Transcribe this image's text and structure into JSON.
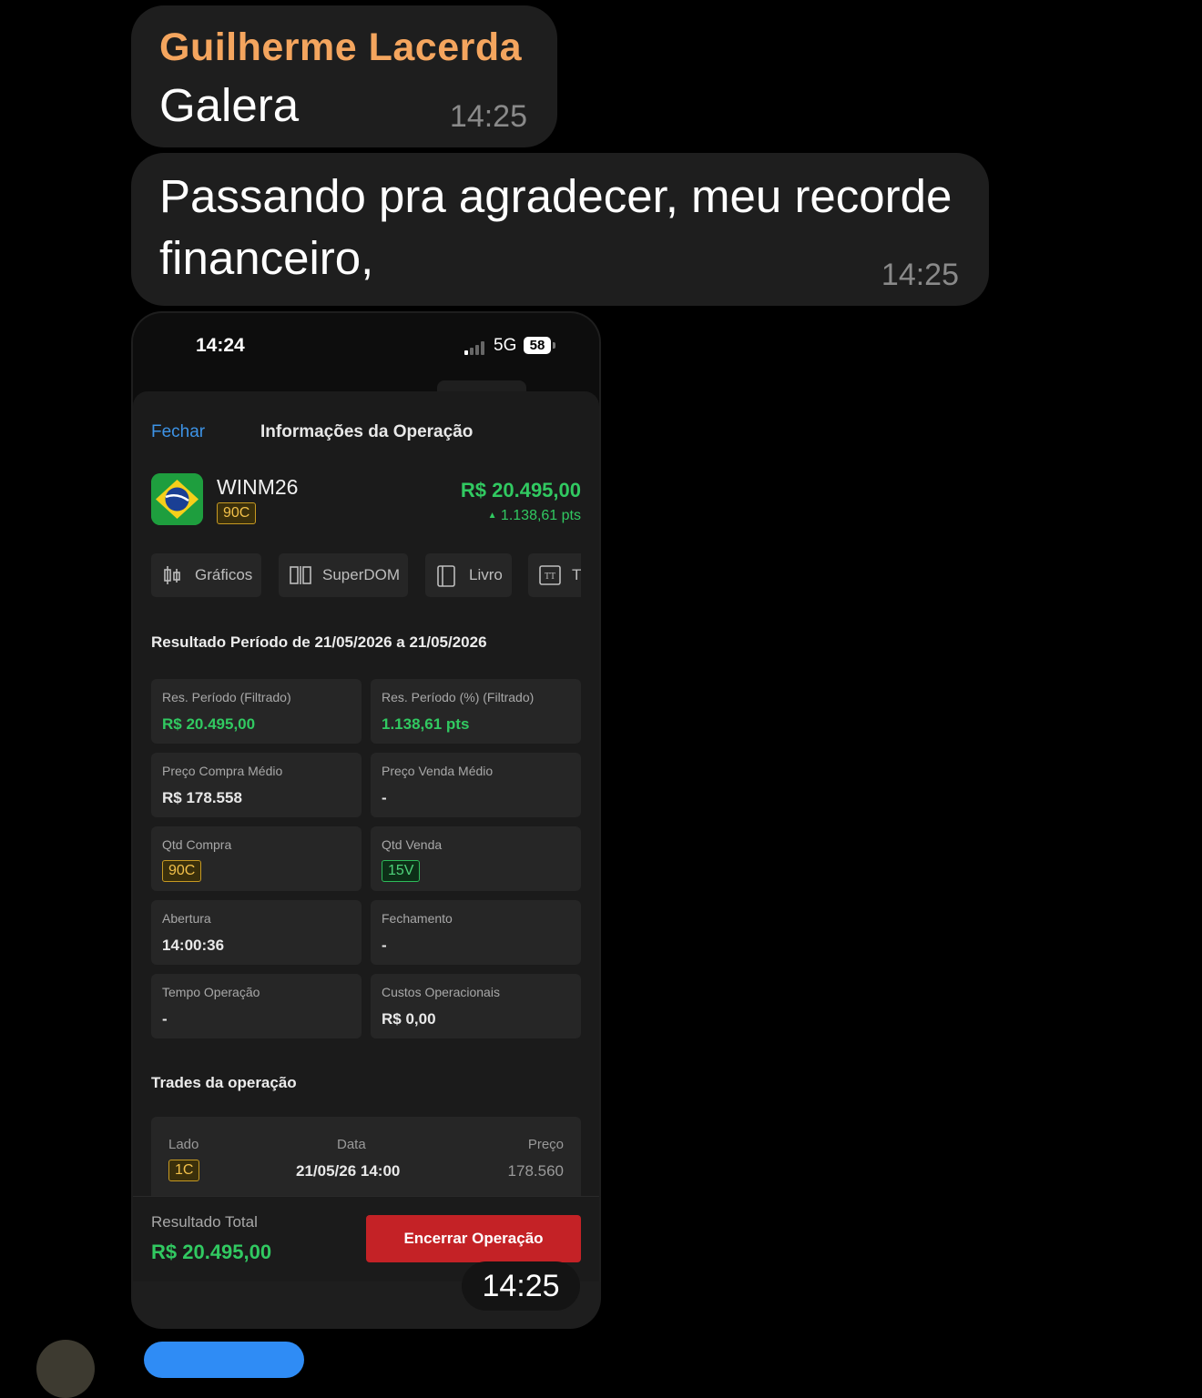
{
  "messages": [
    {
      "sender": "Guilherme Lacerda",
      "text": "Galera",
      "time": "14:25"
    },
    {
      "text": "Passando pra agradecer, meu recorde financeiro,",
      "time": "14:25"
    }
  ],
  "image_message": {
    "time": "14:25",
    "phone": {
      "status_time": "14:24",
      "network": "5G",
      "battery": "58",
      "header": {
        "close_label": "Fechar",
        "title": "Informações da Operação"
      },
      "asset": {
        "symbol": "WINM26",
        "position_badge": "90C",
        "result": "R$ 20.495,00",
        "points": "1.138,61 pts"
      },
      "tabs": [
        "Gráficos",
        "SuperDOM",
        "Livro",
        "T"
      ],
      "period_title": "Resultado Período de 21/05/2026 a 21/05/2026",
      "cards": {
        "res_periodo": {
          "label": "Res. Período (Filtrado)",
          "value": "R$ 20.495,00"
        },
        "res_periodo_pct": {
          "label": "Res. Período (%) (Filtrado)",
          "value": "1.138,61 pts"
        },
        "preco_compra": {
          "label": "Preço Compra Médio",
          "value": "R$ 178.558"
        },
        "preco_venda": {
          "label": "Preço Venda Médio",
          "value": "-"
        },
        "qtd_compra": {
          "label": "Qtd Compra",
          "value": "90C"
        },
        "qtd_venda": {
          "label": "Qtd Venda",
          "value": "15V"
        },
        "abertura": {
          "label": "Abertura",
          "value": "14:00:36"
        },
        "fechamento": {
          "label": "Fechamento",
          "value": "-"
        },
        "tempo": {
          "label": "Tempo Operação",
          "value": "-"
        },
        "custos": {
          "label": "Custos Operacionais",
          "value": "R$ 0,00"
        }
      },
      "trades_title": "Trades da operação",
      "trade": {
        "headers": {
          "side": "Lado",
          "date": "Data",
          "price": "Preço"
        },
        "side": "1C",
        "date": "21/05/26 14:00",
        "price": "178.560"
      },
      "footer": {
        "total_label": "Resultado Total",
        "total_value": "R$ 20.495,00",
        "close_button": "Encerrar Operação"
      }
    }
  },
  "colors": {
    "sender_name": "#f4a55e",
    "bubble": "#1e1e1e",
    "profit_green": "#31c961",
    "link_blue": "#3d93e6",
    "close_red": "#c42226"
  }
}
